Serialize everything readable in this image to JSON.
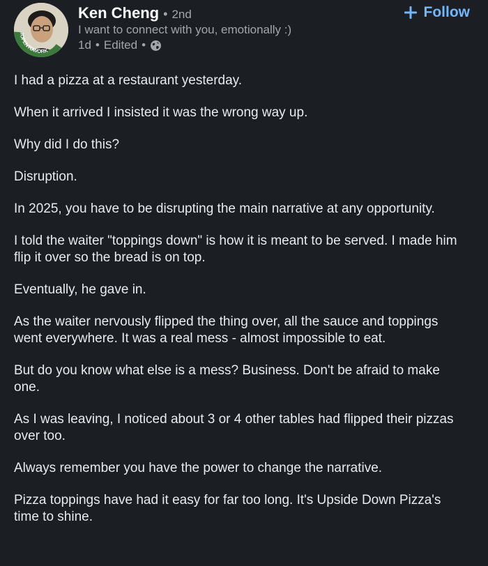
{
  "author": {
    "name": "Ken Cheng",
    "degree": "2nd",
    "headline": "I want to connect with you, emotionally :)",
    "time": "1d",
    "edited": "Edited",
    "badge_text": "#OPENTOWORK"
  },
  "follow_button": {
    "label": "Follow"
  },
  "post": {
    "paragraphs": [
      "I had a pizza at a restaurant yesterday.",
      "When it arrived I insisted it was the wrong way up.",
      "Why did I do this?",
      "Disruption.",
      "In 2025, you have to be disrupting the main narrative at any opportunity.",
      "I told the waiter \"toppings down\" is how it is meant to be served. I made him flip it over so the bread is on top.",
      "Eventually, he gave in.",
      "As the waiter nervously flipped the thing over, all the sauce and toppings went everywhere. It was a real mess - almost impossible to eat.",
      "But do you know what else is a mess? Business. Don't be afraid to make one.",
      "As I was leaving, I noticed about 3 or 4 other tables had flipped their pizzas over too.",
      "Always remember you have the power to change the narrative.",
      "Pizza toppings have had it easy for far too long. It's Upside Down Pizza's time to shine."
    ]
  },
  "colors": {
    "background": "#1b1f23",
    "text": "#e9eaeb",
    "secondary_text": "#a3a6a9",
    "accent": "#71b7fb",
    "open_to_work_green": "#3b7a3a"
  },
  "icons": {
    "visibility": "globe-icon",
    "follow": "plus-icon"
  }
}
